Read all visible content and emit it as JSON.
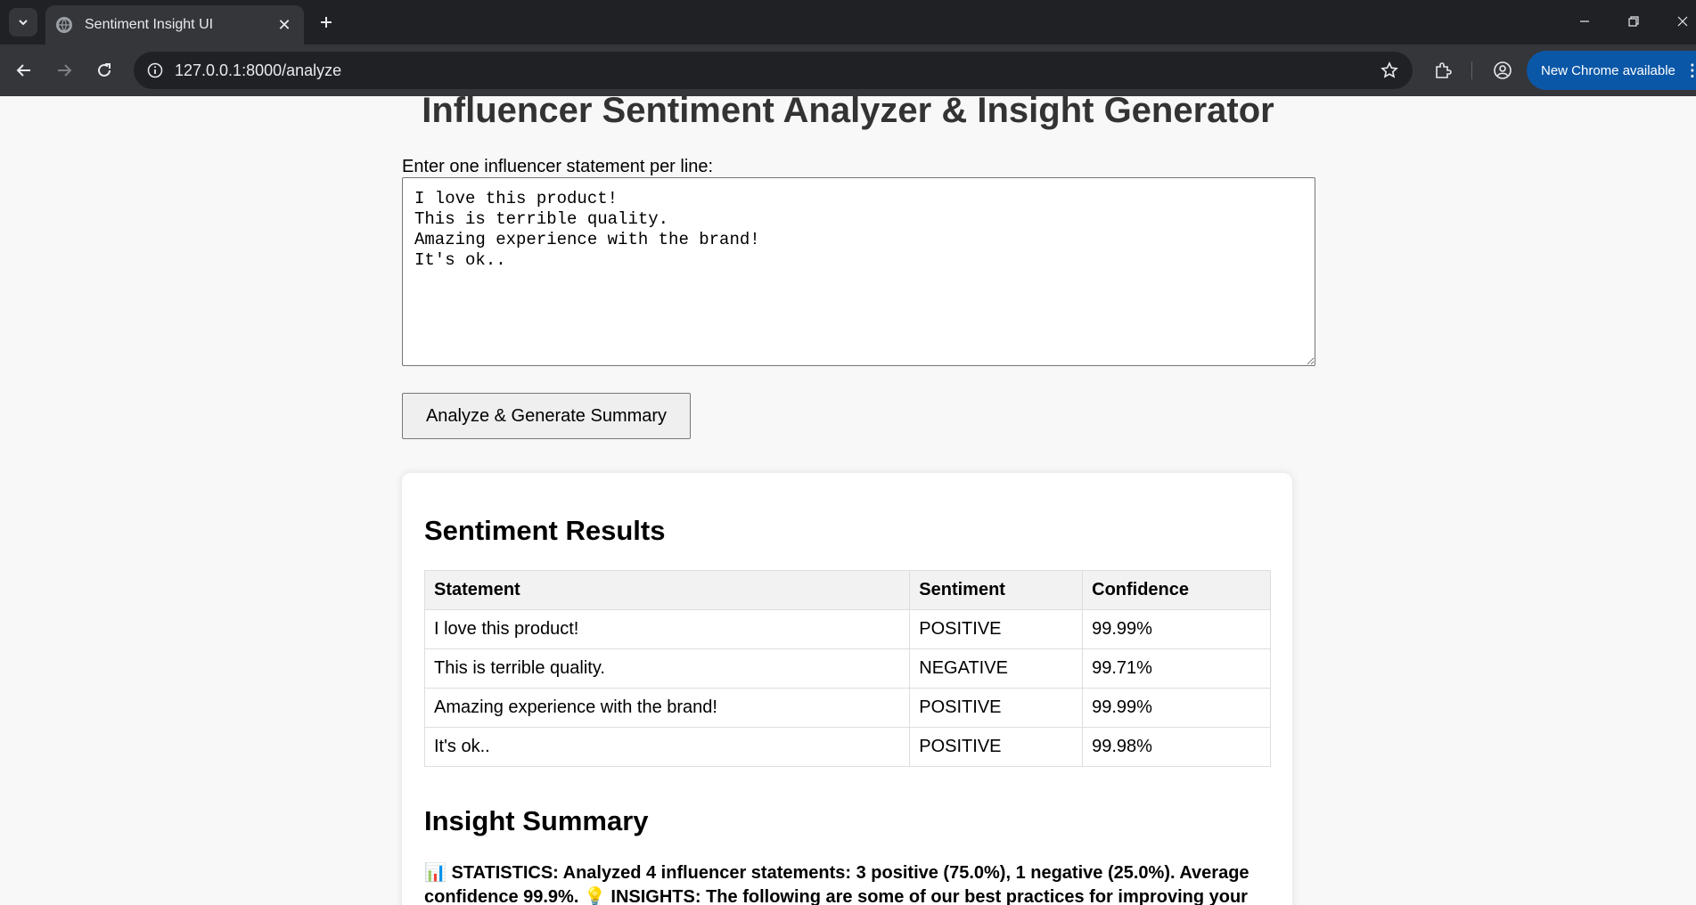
{
  "browser": {
    "tab_title": "Sentiment Insight UI",
    "url": "127.0.0.1:8000/analyze",
    "update_label": "New Chrome available"
  },
  "page": {
    "title": "Influencer Sentiment Analyzer & Insight Generator",
    "input_label": "Enter one influencer statement per line:",
    "input_value": "I love this product!\nThis is terrible quality.\nAmazing experience with the brand!\nIt's ok..",
    "analyze_button": "Analyze & Generate Summary"
  },
  "results": {
    "title": "Sentiment Results",
    "columns": [
      "Statement",
      "Sentiment",
      "Confidence"
    ],
    "rows": [
      {
        "statement": "I love this product!",
        "sentiment": "POSITIVE",
        "confidence": "99.99%"
      },
      {
        "statement": "This is terrible quality.",
        "sentiment": "NEGATIVE",
        "confidence": "99.71%"
      },
      {
        "statement": "Amazing experience with the brand!",
        "sentiment": "POSITIVE",
        "confidence": "99.99%"
      },
      {
        "statement": "It's ok..",
        "sentiment": "POSITIVE",
        "confidence": "99.98%"
      }
    ]
  },
  "summary": {
    "title": "Insight Summary",
    "text": "📊 STATISTICS: Analyzed 4 influencer statements: 3 positive (75.0%), 1 negative (25.0%). Average confidence 99.9%. 💡 INSIGHTS: The following are some of our best practices for improving your online presence in order to improve how you interact with other people (and their audience)."
  }
}
